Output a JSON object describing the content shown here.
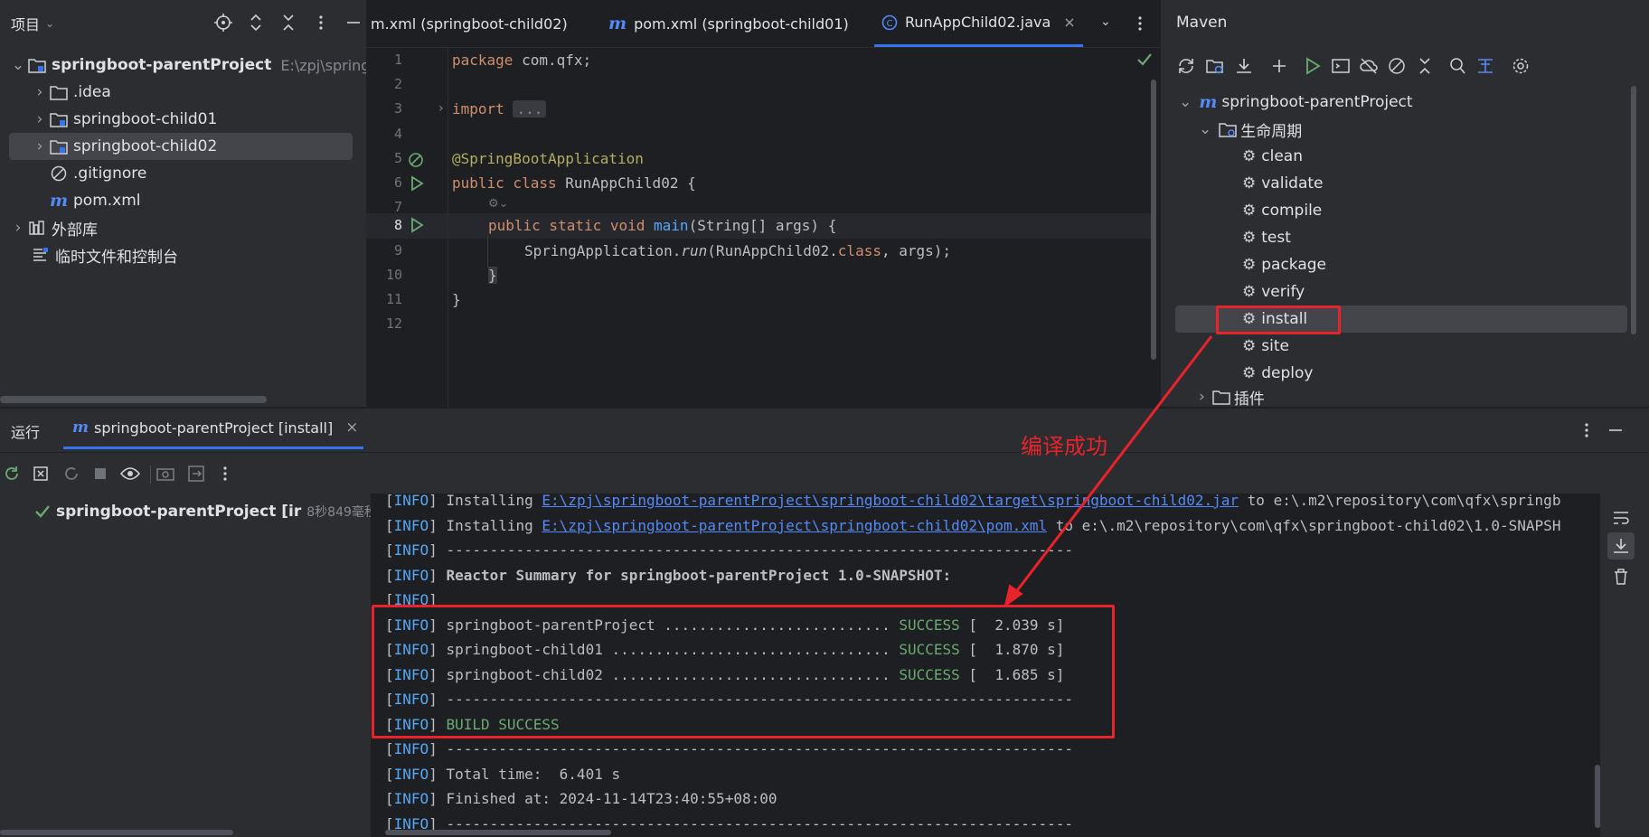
{
  "project": {
    "title": "项目",
    "tree": [
      {
        "label": "springboot-parentProject",
        "hint": "E:\\zpj\\springbo"
      },
      {
        "label": ".idea"
      },
      {
        "label": "springboot-child01"
      },
      {
        "label": "springboot-child02"
      },
      {
        "label": ".gitignore"
      },
      {
        "label": "pom.xml"
      },
      {
        "label": "外部库"
      },
      {
        "label": "临时文件和控制台"
      }
    ]
  },
  "editor": {
    "tabs": [
      {
        "label": "m.xml (springboot-child02)"
      },
      {
        "label": "pom.xml (springboot-child01)"
      },
      {
        "label": "RunAppChild02.java",
        "active": true
      }
    ],
    "line_numbers": [
      "1",
      "2",
      "3",
      "4",
      "5",
      "6",
      "7",
      "8",
      "9",
      "10",
      "11",
      "12"
    ],
    "code": {
      "l1_kw": "package",
      "l1_rest": " com.qfx;",
      "l3_kw": "import",
      "l3_fold": "...",
      "l6": "@SpringBootApplication",
      "l7_kw": "public class",
      "l7_rest": " RunAppChild02 {",
      "l8_kw": "public static void",
      "l8_fn": "main",
      "l8_rest": "(String[] args) {",
      "l9_a": "SpringApplication.",
      "l9_b": "run",
      "l9_c": "(RunAppChild02.",
      "l9_d": "class",
      "l9_e": ", args);",
      "l10": "}",
      "l11": "}"
    }
  },
  "maven": {
    "title": "Maven",
    "root": "springboot-parentProject",
    "lifecycle": "生命周期",
    "goals": [
      "clean",
      "validate",
      "compile",
      "test",
      "package",
      "verify",
      "install",
      "site",
      "deploy"
    ],
    "plugins": "插件"
  },
  "run": {
    "tab_run": "运行",
    "tab_config": "springboot-parentProject [install]",
    "tree_item": "springboot-parentProject [ir",
    "tree_time": "8秒849毫秒"
  },
  "console": {
    "tag": "[INFO]",
    "lines": [
      {
        "text": "Installing ",
        "link": "E:\\zpj\\springboot-parentProject\\springboot-child02\\target\\springboot-child02.jar",
        "tail": " to e:\\.m2\\repository\\com\\qfx\\springb"
      },
      {
        "text": "Installing ",
        "link": "E:\\zpj\\springboot-parentProject\\springboot-child02\\pom.xml",
        "tail": " to e:\\.m2\\repository\\com\\qfx\\springboot-child02\\1.0-SNAPSH"
      },
      {
        "text": "------------------------------------------------------------------------"
      },
      {
        "text": "Reactor Summary for springboot-parentProject 1.0-SNAPSHOT:",
        "bold": true
      },
      {
        "text": ""
      },
      {
        "text": "springboot-parentProject .......................... ",
        "succ": "SUCCESS",
        "tail": " [  2.039 s]"
      },
      {
        "text": "springboot-child01 ................................ ",
        "succ": "SUCCESS",
        "tail": " [  1.870 s]"
      },
      {
        "text": "springboot-child02 ................................ ",
        "succ": "SUCCESS",
        "tail": " [  1.685 s]"
      },
      {
        "text": "------------------------------------------------------------------------"
      },
      {
        "text": "",
        "succ": "BUILD SUCCESS"
      },
      {
        "text": "------------------------------------------------------------------------"
      },
      {
        "text": "Total time:  6.401 s"
      },
      {
        "text": "Finished at: 2024-11-14T23:40:55+08:00"
      },
      {
        "text": "------------------------------------------------------------------------"
      }
    ]
  },
  "annotation": {
    "text": "编译成功",
    "color": "#e8232b"
  }
}
